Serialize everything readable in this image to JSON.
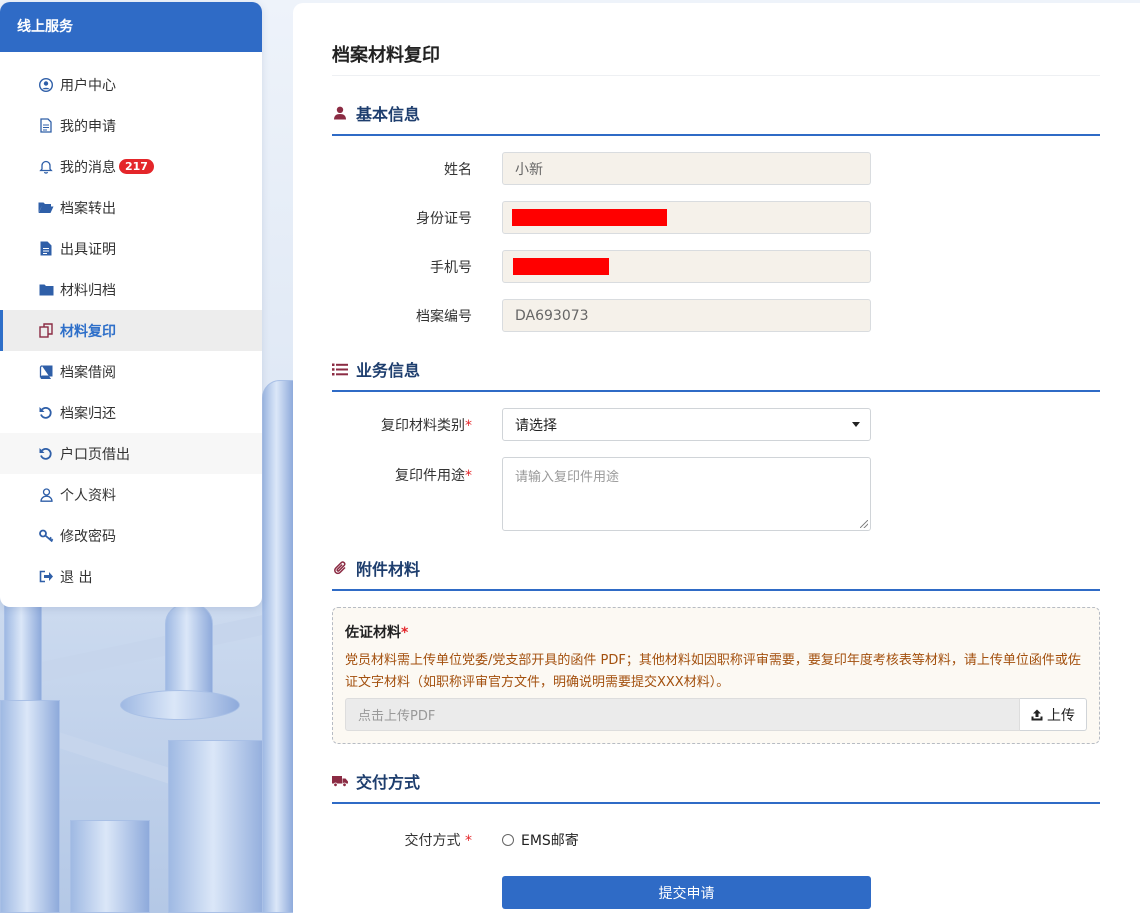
{
  "sidebar": {
    "title": "线上服务",
    "items": [
      {
        "label": "用户中心",
        "icon": "user-circle-icon"
      },
      {
        "label": "我的申请",
        "icon": "document-icon"
      },
      {
        "label": "我的消息",
        "icon": "bell-icon",
        "badge": "217"
      },
      {
        "label": "档案转出",
        "icon": "folder-open-icon"
      },
      {
        "label": "出具证明",
        "icon": "file-text-icon"
      },
      {
        "label": "材料归档",
        "icon": "folder-icon"
      },
      {
        "label": "材料复印",
        "icon": "copy-icon",
        "active": true
      },
      {
        "label": "档案借阅",
        "icon": "book-icon"
      },
      {
        "label": "档案归还",
        "icon": "undo-icon"
      },
      {
        "label": "户口页借出",
        "icon": "undo-icon"
      },
      {
        "label": "个人资料",
        "icon": "person-icon"
      },
      {
        "label": "修改密码",
        "icon": "key-icon"
      },
      {
        "label": "退 出",
        "icon": "sign-out-icon"
      }
    ]
  },
  "page": {
    "title": "档案材料复印"
  },
  "basic_info": {
    "heading": "基本信息",
    "name_label": "姓名",
    "name_value": "小新",
    "id_label": "身份证号",
    "phone_label": "手机号",
    "archive_label": "档案编号",
    "archive_value": "DA693073"
  },
  "business_info": {
    "heading": "业务信息",
    "category_label": "复印材料类别",
    "category_value": "请选择",
    "purpose_label": "复印件用途",
    "purpose_placeholder": "请输入复印件用途"
  },
  "attachments": {
    "heading": "附件材料",
    "box_title": "佐证材料",
    "description": "党员材料需上传单位党委/党支部开具的函件 PDF；其他材料如因职称评审需要，要复印年度考核表等材料，请上传单位函件或佐证文字材料（如职称评审官方文件，明确说明需要提交XXX材料）。",
    "upload_placeholder": "点击上传PDF",
    "upload_button": "上传"
  },
  "delivery": {
    "heading": "交付方式",
    "label": "交付方式",
    "option_ems": "EMS邮寄"
  },
  "submit_label": "提交申请",
  "colors": {
    "primary": "#2f6bc6",
    "required": "#e4262a",
    "badge": "#e4262a",
    "warning_text": "#a3500e"
  }
}
